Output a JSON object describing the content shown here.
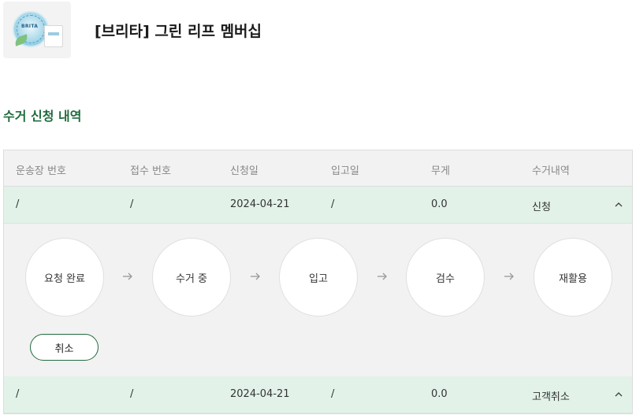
{
  "product": {
    "title": "[브리타] 그린 리프 멤버십",
    "image_icon": "product-thumbnail",
    "badge_text": "BRITA"
  },
  "section": {
    "title": "수거 신청 내역"
  },
  "table": {
    "columns": [
      "운송장 번호",
      "접수 번호",
      "신청일",
      "입고일",
      "무게",
      "수거내역"
    ],
    "rows": [
      {
        "tracking_no": "/",
        "receipt_no": "/",
        "request_date": "2024-04-21",
        "warehouse_date": "/",
        "weight": "0.0",
        "status": "신청",
        "expanded": true
      },
      {
        "tracking_no": "/",
        "receipt_no": "/",
        "request_date": "2024-04-21",
        "warehouse_date": "/",
        "weight": "0.0",
        "status": "고객취소",
        "expanded": false
      }
    ]
  },
  "progress": {
    "steps": [
      "요청 완료",
      "수거 중",
      "입고",
      "검수",
      "재활용"
    ],
    "cancel_label": "취소"
  },
  "colors": {
    "accent_green": "#1f6b3d",
    "row_highlight": "#e2f2e9",
    "panel_bg": "#f2f2f2"
  },
  "icons": {
    "arrow": "arrow-right-icon",
    "collapse": "chevron-up-icon"
  }
}
